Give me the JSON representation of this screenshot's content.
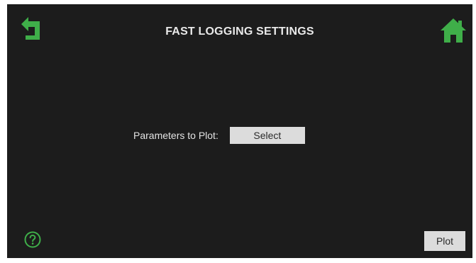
{
  "header": {
    "title": "FAST LOGGING SETTINGS",
    "back_icon": "back-arrow-icon",
    "home_icon": "home-icon"
  },
  "main": {
    "parameters_label": "Parameters to Plot:",
    "select_label": "Select"
  },
  "footer": {
    "help_icon": "help-icon",
    "plot_label": "Plot"
  },
  "colors": {
    "background": "#1c1c1c",
    "accent_green": "#3fae49",
    "button_bg": "#dcdcdc",
    "text_light": "#e9e9e9"
  }
}
